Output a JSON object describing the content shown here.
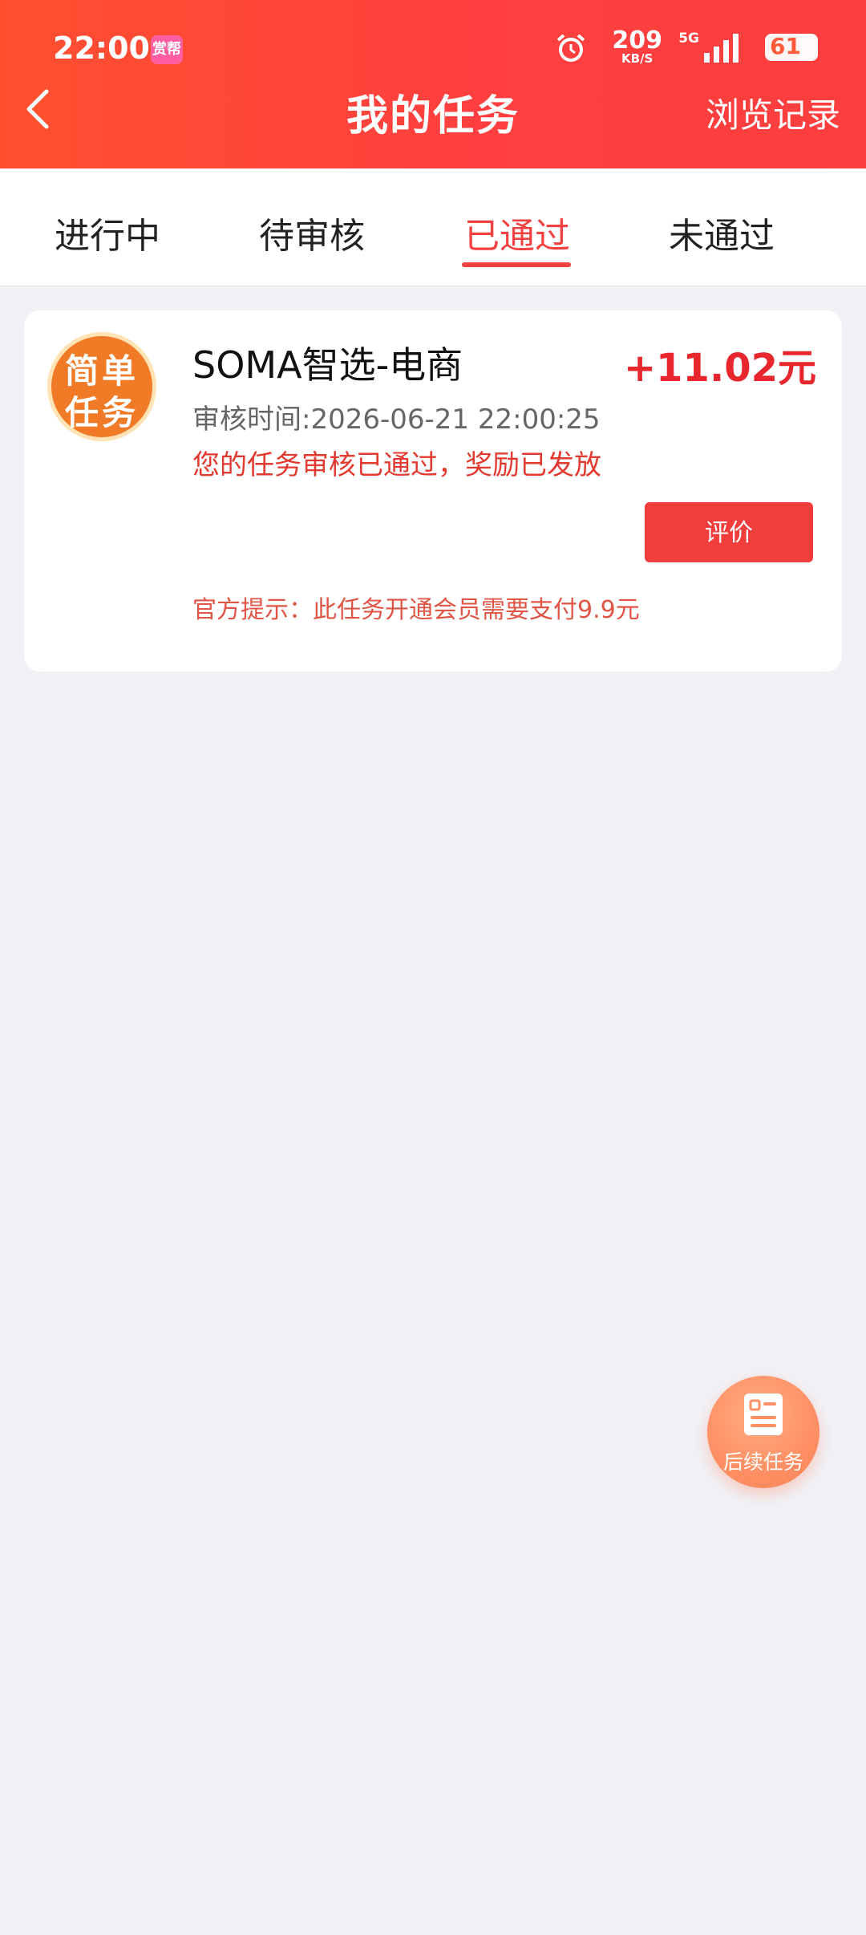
{
  "status_bar": {
    "time": "22:00",
    "app_badge": "赏帮",
    "net_speed": "209",
    "net_speed_unit": "KB/S",
    "network": "5G",
    "battery": "61"
  },
  "header": {
    "title": "我的任务",
    "history_label": "浏览记录"
  },
  "tabs": [
    {
      "label": "进行中",
      "active": false
    },
    {
      "label": "待审核",
      "active": false
    },
    {
      "label": "已通过",
      "active": true
    },
    {
      "label": "未通过",
      "active": false
    }
  ],
  "task": {
    "logo_line1": "简单",
    "logo_line2": "任务",
    "name": "SOMA智选-电商",
    "reward": "+11.02元",
    "review_time": "审核时间:2026-06-21 22:00:25",
    "status_msg": "您的任务审核已通过，奖励已发放",
    "review_button": "评价",
    "official_tip": "官方提示：此任务开通会员需要支付9.9元"
  },
  "fab": {
    "label": "后续任务"
  },
  "colors": {
    "header": "#ff4040",
    "accent": "#f24141",
    "reward": "#e8262e",
    "background": "#f1f1f6"
  }
}
